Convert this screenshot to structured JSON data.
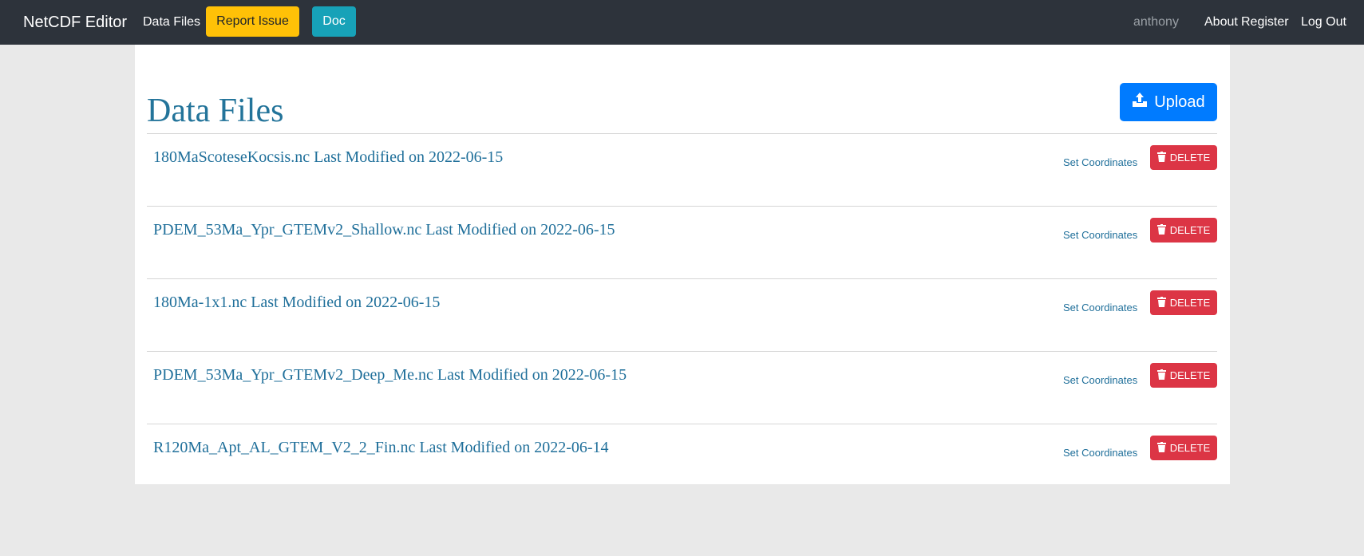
{
  "navbar": {
    "brand": "NetCDF Editor",
    "data_files_link": "Data Files",
    "report_issue_label": "Report Issue",
    "doc_label": "Doc",
    "username": "anthony",
    "about_link": "About",
    "register_link": "Register",
    "logout_link": "Log Out"
  },
  "main": {
    "title": "Data Files",
    "upload_label": "Upload",
    "upload_icon": "upload-icon",
    "files": [
      {
        "label": "180MaScoteseKocsis.nc Last Modified on 2022-06-15",
        "set_coords": "Set Coordinates",
        "delete": "DELETE"
      },
      {
        "label": "PDEM_53Ma_Ypr_GTEMv2_Shallow.nc Last Modified on 2022-06-15",
        "set_coords": "Set Coordinates",
        "delete": "DELETE"
      },
      {
        "label": "180Ma-1x1.nc Last Modified on 2022-06-15",
        "set_coords": "Set Coordinates",
        "delete": "DELETE"
      },
      {
        "label": "PDEM_53Ma_Ypr_GTEMv2_Deep_Me.nc Last Modified on 2022-06-15",
        "set_coords": "Set Coordinates",
        "delete": "DELETE"
      },
      {
        "label": "R120Ma_Apt_AL_GTEM_V2_2_Fin.nc Last Modified on 2022-06-14",
        "set_coords": "Set Coordinates",
        "delete": "DELETE"
      }
    ]
  },
  "colors": {
    "navbar_bg": "#2d333b",
    "report_issue": "#ffc107",
    "doc": "#17a2b8",
    "upload": "#007bff",
    "delete": "#dc3545",
    "link": "#1f6f9a"
  }
}
